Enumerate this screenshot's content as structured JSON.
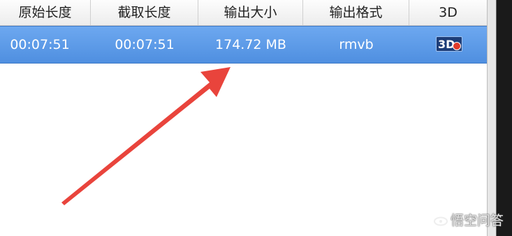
{
  "table": {
    "columns": [
      "原始长度",
      "截取长度",
      "输出大小",
      "输出格式",
      "3D"
    ],
    "rows": [
      {
        "original_length": "00:07:51",
        "clip_length": "00:07:51",
        "output_size": "174.72 MB",
        "output_format": "rmvb",
        "three_d_icon_label": "3D"
      }
    ],
    "selected_row_index": 0
  },
  "watermark": {
    "text": "悟空问答"
  },
  "colors": {
    "selection": "#5a98e8",
    "arrow": "#e83a32",
    "header_bg": "#f2f2f2"
  },
  "icons": [
    "3d-format-icon",
    "annotation-arrow",
    "watermark-logo-icon"
  ]
}
